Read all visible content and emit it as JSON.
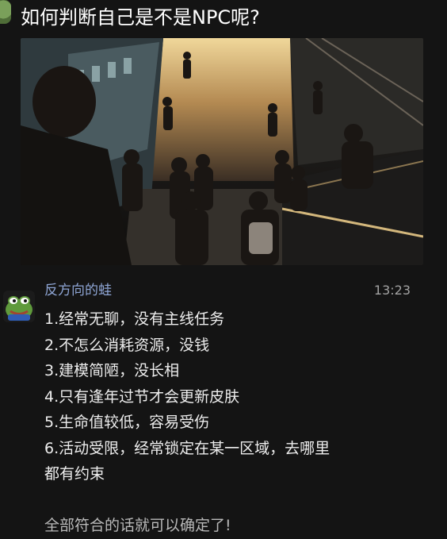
{
  "post": {
    "title": "如何判断自己是不是NPC呢?"
  },
  "message": {
    "sender": "反方向的蛙",
    "time": "13:23",
    "lines": [
      "1.经常无聊，没有主线任务",
      "2.不怎么消耗资源，没钱",
      "3.建模简陋，没长相",
      "4.只有逢年过节才会更新皮肤",
      "5.生命值较低，容易受伤",
      "6.活动受限，经常锁定在某一区域，去哪里",
      "都有约束"
    ],
    "closing": "全部符合的话就可以确定了!"
  }
}
